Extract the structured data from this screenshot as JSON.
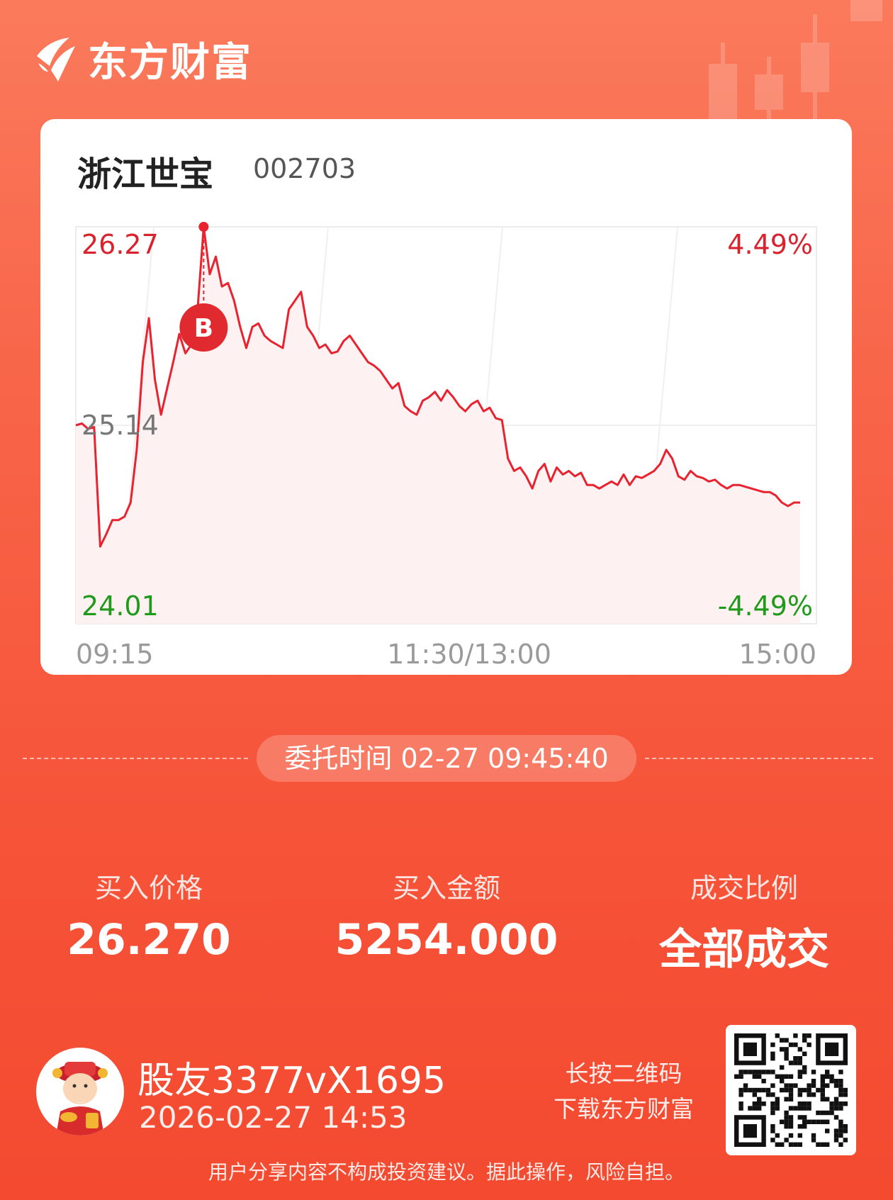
{
  "brand": {
    "name": "东方财富",
    "color": "#f65338"
  },
  "stock": {
    "name": "浙江世宝",
    "code": "002703"
  },
  "chart_data": {
    "type": "line",
    "series": [
      {
        "values": [
          25.14,
          25.15,
          25.12,
          25.13,
          24.45,
          24.52,
          24.6,
          24.6,
          24.62,
          24.7,
          25.0,
          25.5,
          25.75,
          25.4,
          25.2,
          25.35,
          25.5,
          25.66,
          25.55,
          25.6,
          25.8,
          26.27,
          26.0,
          26.1,
          25.93,
          25.95,
          25.85,
          25.7,
          25.58,
          25.7,
          25.72,
          25.65,
          25.62,
          25.6,
          25.58,
          25.8,
          25.85,
          25.9,
          25.7,
          25.65,
          25.58,
          25.6,
          25.55,
          25.56,
          25.62,
          25.65,
          25.6,
          25.55,
          25.5,
          25.48,
          25.45,
          25.4,
          25.35,
          25.38,
          25.25,
          25.22,
          25.2,
          25.28,
          25.3,
          25.33,
          25.28,
          25.34,
          25.3,
          25.25,
          25.22,
          25.26,
          25.28,
          25.22,
          25.24,
          25.18,
          25.17,
          24.95,
          24.88,
          24.9,
          24.85,
          24.78,
          24.88,
          24.92,
          24.82,
          24.9,
          24.86,
          24.88,
          24.85,
          24.87,
          24.8,
          24.8,
          24.78,
          24.8,
          24.82,
          24.8,
          24.86,
          24.8,
          24.85,
          24.84,
          24.86,
          24.88,
          24.92,
          25.0,
          24.95,
          24.85,
          24.83,
          24.88,
          24.85,
          24.84,
          24.82,
          24.83,
          24.8,
          24.78,
          24.8,
          24.8,
          24.79,
          24.78,
          24.77,
          24.76,
          24.76,
          24.74,
          24.7,
          24.68,
          24.7,
          24.7
        ]
      }
    ],
    "ylim": [
      24.01,
      26.27
    ],
    "base_price": 25.14,
    "y_labels": {
      "high": "26.27",
      "mid": "25.14",
      "low": "24.01"
    },
    "pct_labels": {
      "high": "4.49%",
      "low": "-4.49%"
    },
    "x_labels": [
      "09:15",
      "11:30/13:00",
      "15:00"
    ],
    "buy_marker": {
      "label": "B",
      "price": 26.27
    },
    "colors": {
      "line": "#e8232f",
      "fill": "#fdf1f2",
      "up": "#d8232f",
      "down": "#1f9a1a",
      "neutral": "#777777"
    }
  },
  "order": {
    "time_label": "委托时间 02-27 09:45:40"
  },
  "stats": [
    {
      "label": "买入价格",
      "value": "26.270"
    },
    {
      "label": "买入金额",
      "value": "5254.000"
    },
    {
      "label": "成交比例",
      "value": "全部成交"
    }
  ],
  "user": {
    "name": "股友3377vX1695",
    "time": "2026-02-27 14:53"
  },
  "qr_hint": {
    "line1": "长按二维码",
    "line2": "下载东方财富"
  },
  "disclaimer": "用户分享内容不构成投资建议。据此操作，风险自担。"
}
